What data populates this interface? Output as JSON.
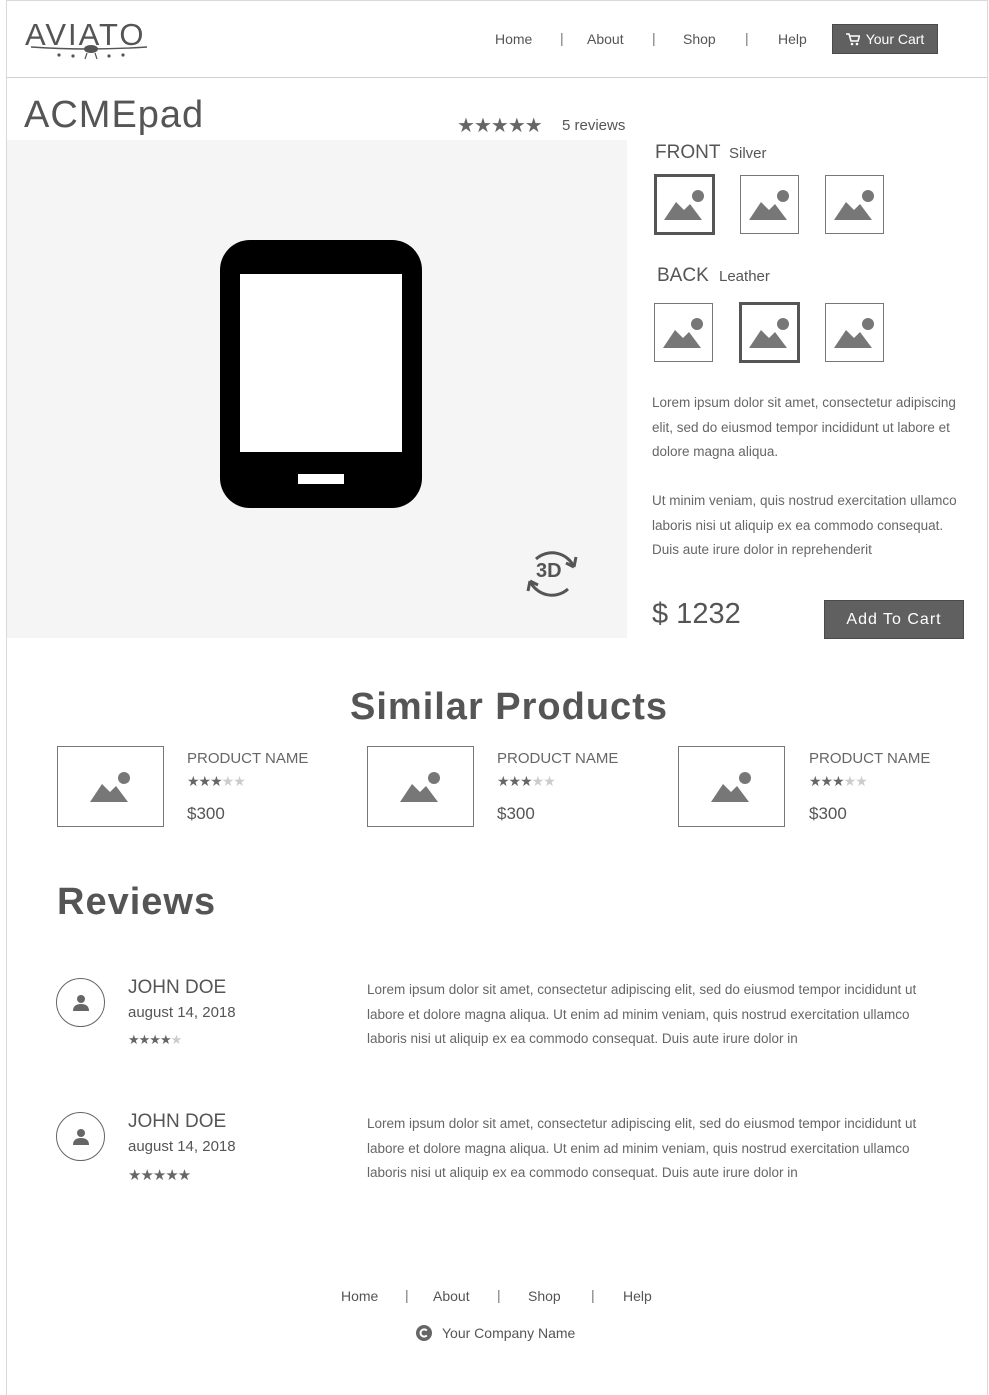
{
  "header": {
    "logo": "AVIATO",
    "nav": [
      "Home",
      "About",
      "Shop",
      "Help"
    ],
    "cart_label": "Your Cart"
  },
  "product": {
    "title": "ACMEpad",
    "rating": 5,
    "reviews_label": "5 reviews",
    "front_label": "FRONT",
    "front_value": "Silver",
    "back_label": "BACK",
    "back_value": "Leather",
    "front_selected": 1,
    "back_selected": 2,
    "desc_p1": "Lorem ipsum dolor sit amet, consectetur adipiscing elit, sed do eiusmod tempor incididunt ut labore et dolore magna aliqua.",
    "desc_p2": "Ut minim veniam, quis nostrud exercitation ullamco laboris nisi ut aliquip ex ea commodo consequat. Duis aute irure dolor in reprehenderit",
    "price": "$ 1232",
    "add_to_cart": "Add To Cart",
    "badge_3d": "3D"
  },
  "similar": {
    "title": "Similar Products",
    "items": [
      {
        "name": "PRODUCT NAME",
        "rating": 3,
        "price": "$300"
      },
      {
        "name": "PRODUCT NAME",
        "rating": 3,
        "price": "$300"
      },
      {
        "name": "PRODUCT NAME",
        "rating": 3,
        "price": "$300"
      }
    ]
  },
  "reviews": {
    "title": "Reviews",
    "items": [
      {
        "name": "JOHN DOE",
        "date": "august 14, 2018",
        "rating": 4,
        "text": "Lorem ipsum dolor sit amet, consectetur adipiscing elit, sed do eiusmod tempor incididunt ut labore et dolore magna aliqua. Ut enim ad minim veniam, quis nostrud exercitation ullamco laboris nisi ut aliquip ex ea commodo consequat. Duis aute irure dolor in"
      },
      {
        "name": "JOHN DOE",
        "date": "august 14, 2018",
        "rating": 5,
        "text": "Lorem ipsum dolor sit amet, consectetur adipiscing elit, sed do eiusmod tempor incididunt ut labore et dolore magna aliqua. Ut enim ad minim veniam, quis nostrud exercitation ullamco laboris nisi ut aliquip ex ea commodo consequat. Duis aute irure dolor in"
      }
    ]
  },
  "footer": {
    "nav": [
      "Home",
      "About",
      "Shop",
      "Help"
    ],
    "company": "Your Company Name"
  },
  "colors": {
    "button_bg": "#606060",
    "viewer_bg": "#f5f5f5",
    "text": "#555555"
  },
  "icons": [
    "plane-icon",
    "cart-icon",
    "image-placeholder-icon",
    "tablet-icon",
    "rotate-3d-icon",
    "user-icon",
    "copyright-icon",
    "star-icon"
  ]
}
